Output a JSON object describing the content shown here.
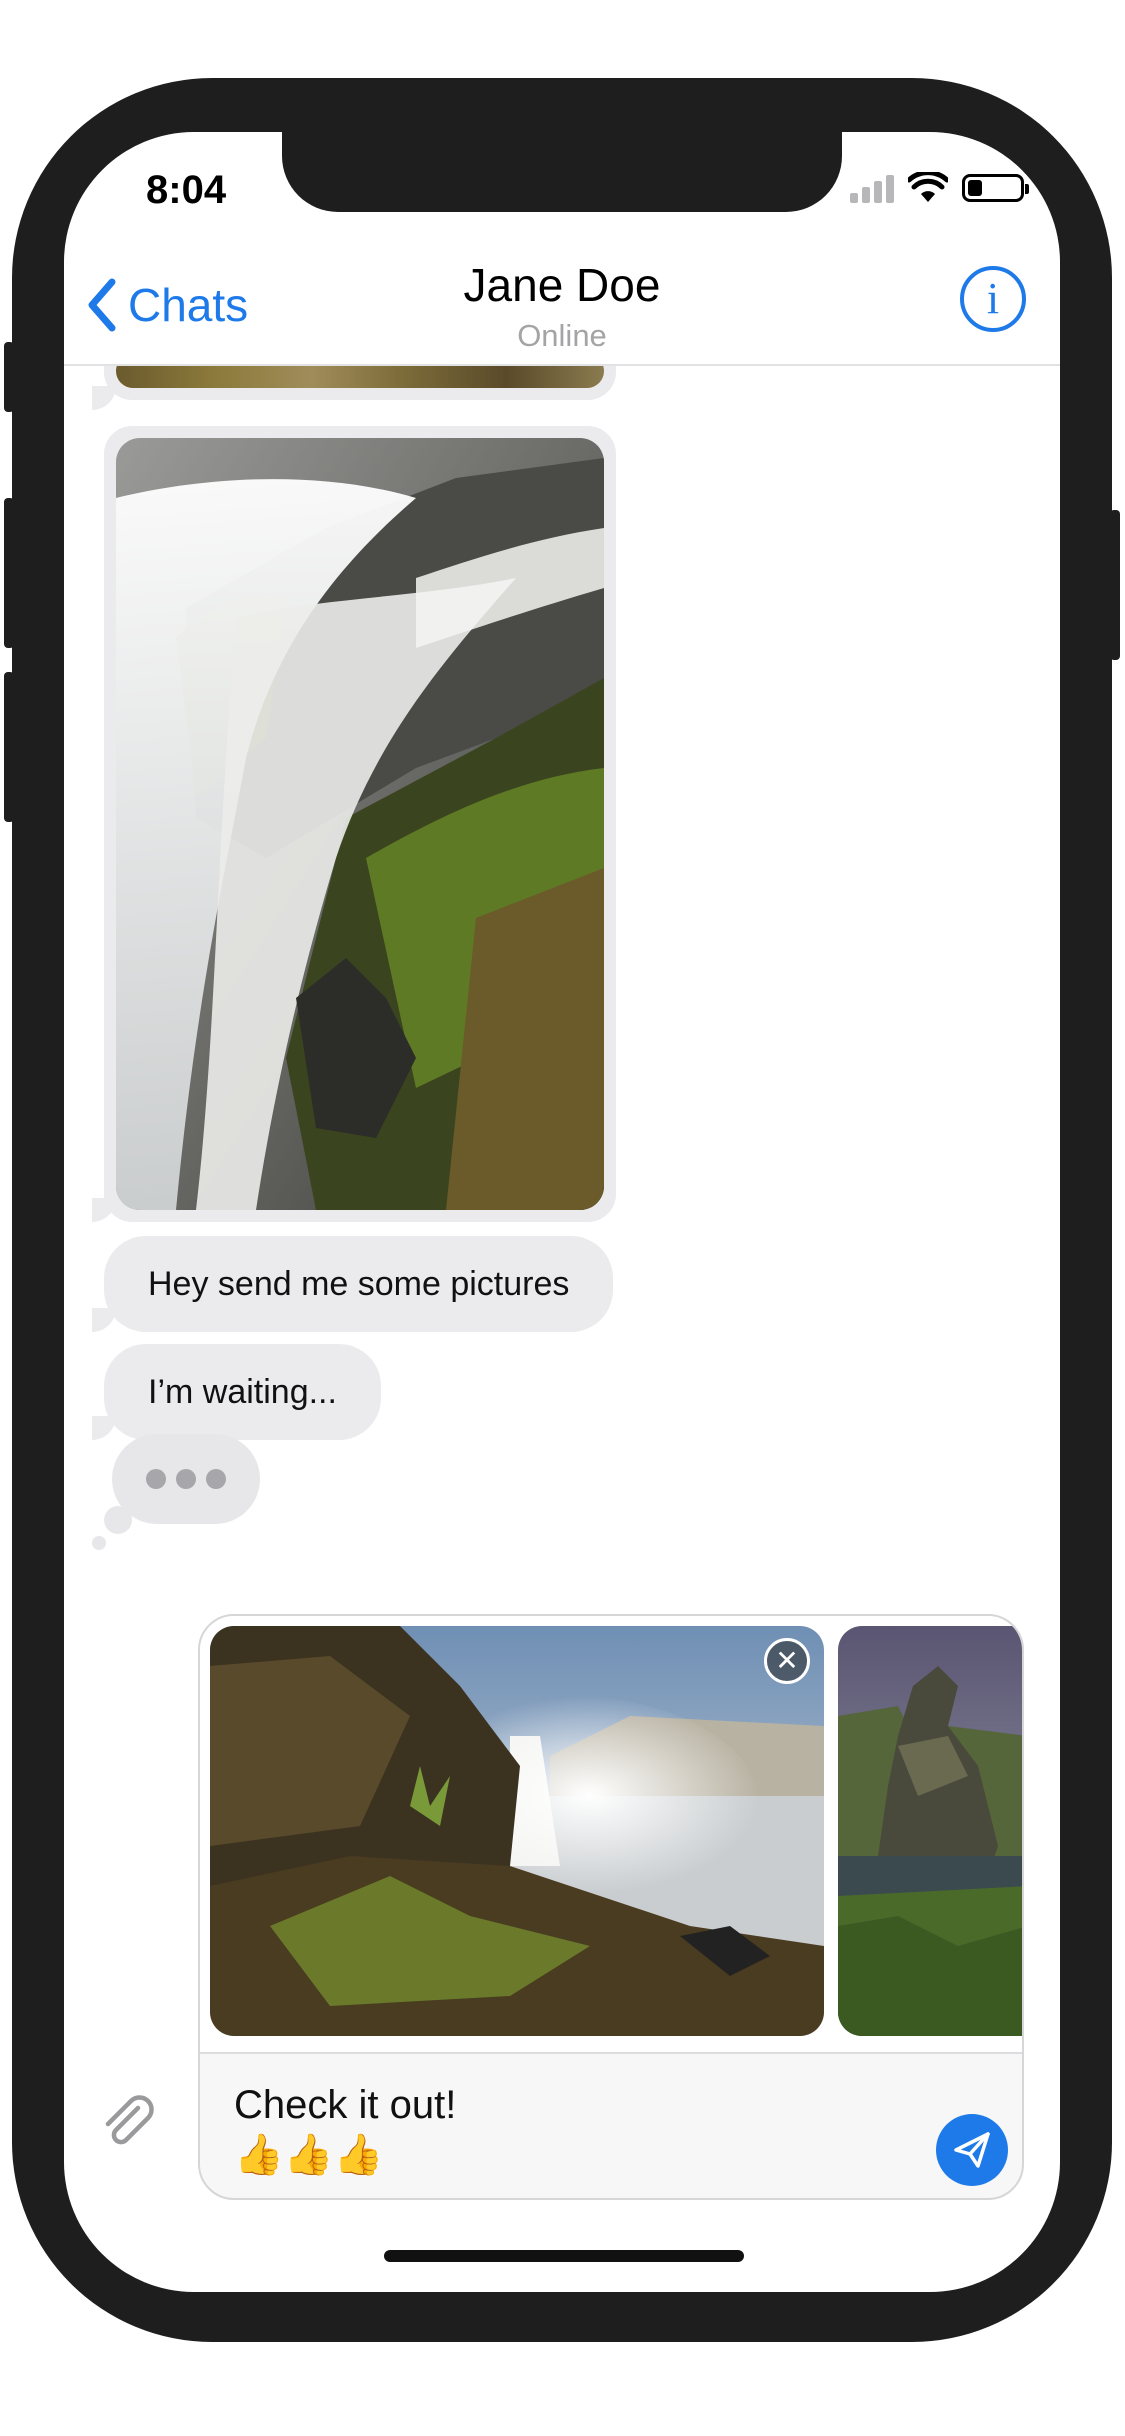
{
  "status_bar": {
    "time": "8:04"
  },
  "header": {
    "back_label": "Chats",
    "contact_name": "Jane Doe",
    "contact_status": "Online",
    "info_label": "i"
  },
  "messages": [
    {
      "type": "image",
      "alt": "waterfall over mossy rocks"
    },
    {
      "type": "text",
      "text": "Hey send me some pictures"
    },
    {
      "type": "text",
      "text": "I’m waiting..."
    }
  ],
  "typing_indicator": true,
  "composer": {
    "attachments": [
      {
        "name": "waterfall-landscape"
      },
      {
        "name": "rock-formation"
      }
    ],
    "text_line1": "Check it out!",
    "text_line2": "👍👍👍"
  },
  "colors": {
    "accent": "#1f7ae9",
    "bubble": "#ebebed",
    "frame": "#1e1e1f"
  },
  "icons": [
    "chevron-left-icon",
    "info-icon",
    "paperclip-icon",
    "send-icon",
    "close-icon",
    "wifi-icon",
    "signal-icon",
    "battery-icon"
  ]
}
